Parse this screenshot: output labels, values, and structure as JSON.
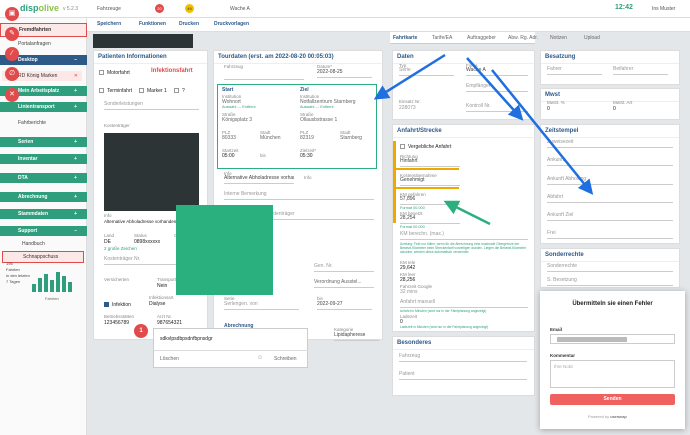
{
  "app": {
    "logo_a": "disp",
    "logo_b": "olive",
    "version": "v 5.2.3"
  },
  "top": {
    "vehicles": "Fahrzeuge",
    "badge1": "20",
    "badge2": "49",
    "vehicle": "Wache A",
    "time": "12:42",
    "user": "Ins Muster"
  },
  "sidebar": {
    "fremdfahrten": "Fremdfahrten",
    "portalanfragen": "Portalanfragen",
    "desktop": "Desktop",
    "mein": "Mein Arbeitsplatz",
    "linientransport": "Linientransport",
    "fahrberichte": "Fahrberichte",
    "serien": "Serien",
    "inventar": "Inventar",
    "dta": "DTA",
    "abrechnung": "Abrechnung",
    "stammdaten": "Stammdaten",
    "support": "Support",
    "handbuch": "Handbuch",
    "schnapp": "Schnappschuss",
    "tag": "RD König Marken",
    "stats": [
      "196",
      "Fahrten",
      "in den letzten",
      "7 Tagen"
    ],
    "fahrten": "Fahrten"
  },
  "toolbar": {
    "save": "Speichern",
    "functions": "Funktionen",
    "print": "Drucken",
    "templates": "Druckvorlagen"
  },
  "patient": {
    "title": "Patienten Informationen",
    "motor": "Motorfahrt",
    "infek": "Infektionsfahrt",
    "termin": "Terminfahrt",
    "marker": "Marker 1",
    "q": "?",
    "sonder": "Sonderleistungen",
    "kosten": "Kostenträger",
    "info": "Info",
    "alt": "Alternative Abholadresse vorhanden!",
    "land": "Land",
    "de": "DE",
    "status": "Status",
    "statusval": "0898xxxxxx",
    "gueltig": "Gültig",
    "gueltig_val": "2 große Zeichen",
    "kosten_nr": "Kostenträger Nr.",
    "versicherten": "Versicherten",
    "transport": "Transport",
    "nein": "Nein",
    "infektion": "Infektion",
    "infektionsart": "Infektionsart",
    "dialyse": "Dialyse",
    "betrieb": "Betriebsstätten",
    "betrieb_val": "123456789",
    "arzt": "Arzt Nr.",
    "arzt_val": "987654321"
  },
  "tour": {
    "title": "Tourdaten (erst. am 2022-08-20 00:05:03)",
    "fahrzeug": "Fahrzeug",
    "datum": "Datum*",
    "date": "2022-08-25",
    "start": "Start",
    "ziel": "Ziel",
    "inst": "Institution",
    "inst_a": "Wohnort",
    "inst_b": "Notfallzentrum Starnberg",
    "auswahl": "Auswahl --- Entfernt",
    "str": "Straße",
    "str_a": "Königsplatz 3",
    "str_b": "Ollausbstrasse 1",
    "plz": "PLZ",
    "plz_a": "80333",
    "plz_b": "82319",
    "stadt": "Stadt",
    "stadt_a": "München",
    "stadt_b": "Starnberg",
    "startzeit": "Startzeit",
    "bis": "bis",
    "zielzeit": "Zielzeit*",
    "time_a": "05:00",
    "time_b": "05:30",
    "info": "Info",
    "infoval": "Alternative Abholadresse vorhan",
    "intern": "Interne Bemerkung",
    "rechnung": "Rechnungstext für Kostenträger",
    "gen": "Gen. Nr.",
    "verordnung": "Verordnung Ausstel...",
    "serie": "Serie",
    "serie_val": "Serlengen. von",
    "bis2": "bis",
    "date2": "2022-09-27",
    "abrechnung": "Abrechnung",
    "kategorie": "Kategorie",
    "kat_val": "Lipidapherese"
  },
  "tabs": [
    "Fahrtkarte",
    "Tarife/EA",
    "Auftraggeber",
    "Abw. Rg. Adr.",
    "Notizen",
    "Upload"
  ],
  "daten": {
    "title": "Daten",
    "typ": "Typ",
    "typ_val": "Serie",
    "firma": "Firma",
    "firma_val": "Wache A",
    "einsatz": "Einsatz Nr.",
    "einsatz_val": "228073",
    "kontrol": "Kontroll Nr.",
    "empf": "Empfänger"
  },
  "anfahrt": {
    "title": "Anfahrt/Strecke",
    "vergeb": "Vergebliche Anfahrt",
    "richtung": "Richtung",
    "richtung_val": "Hinfahrt",
    "kosten": "Kostenübernahme",
    "kosten_val": "Genehmigt",
    "km": "KM gefahren",
    "km_val": "57,896",
    "km_fmt": "Format 00.000",
    "km_bes": "KM besetzt",
    "km_bes_val": "28,254",
    "km_fmt2": "Format 00.000",
    "km_ber": "KM berechn. (max.)",
    "hint": "Achtung: Feld nur füllen, wenn für die Abrechnung eine maximale Obergrenze der Besetzt-Kilometer beim Streckentarif vorzeitigen wurden. Liegen die Besetzt-Kilometer darunter, werden diese automatisch verwendet.",
    "km_tel": "KM tele",
    "km_tel_val": "29,642",
    "km_leer": "KM leer",
    "km_leer_val": "28,256",
    "google": "Fahrzeit Google",
    "google_val": "32 mins",
    "manuell": "Anfahrt manuell",
    "manuell_hint": "Anfahrt in Minuten (wird nur in der Fahrtplanung angezeigt)",
    "ladezeit": "Ladezeit",
    "ladezeit_val": "0",
    "ladezeit_hint": "Ladezeit in Minuten (wird nur in der Fahrtplanung angezeigt)"
  },
  "besonderes": {
    "title": "Besonderes",
    "fahrzeug": "Fahrzeug",
    "patient": "Patient"
  },
  "right": {
    "besatzung": "Besatzung",
    "fahrer": "Fahrer",
    "beifahrer": "Beifahrer",
    "mwst": "Mwst",
    "mwst_a": "MwSt. %",
    "mwst_b": "MwSt. Art",
    "mwst_a_val": "0",
    "mwst_b_val": "0",
    "zeitstempel": "Zeitstempel",
    "zuweiser": "Zuweisezeit",
    "ankunft": "Ankunft",
    "ankunft_abholung": "Ankunft Abholung",
    "abfahrt": "Abfahrt",
    "ankunft_ziel": "Ankunft Ziel",
    "frei": "Frei",
    "sonder": "Sonderrechte",
    "sonder_val": "Sonderrechte",
    "s_besetzung": "S. Besetzung"
  },
  "chat": {
    "text": "sdkvlpsdbpsdnfbpnsdgr",
    "delete": "Löschen",
    "send": "Schreiben"
  },
  "feedback": {
    "title": "Übermitteln sie einen Fehler",
    "email": "Email",
    "comment": "Kommentar",
    "placeholder": "Ihre Notiz",
    "submit": "Senden",
    "powered": "Powered by",
    "brand": "usersnap"
  },
  "colors": {
    "green": "#2e9e7d",
    "red": "#e14b4b",
    "blue": "#2e5a88",
    "teal": "#2ab07f"
  }
}
